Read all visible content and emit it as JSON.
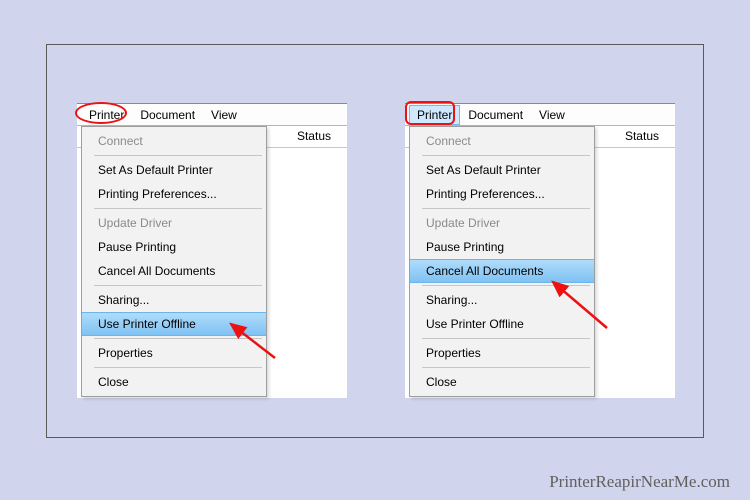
{
  "menubar": {
    "printer": "Printer",
    "document": "Document",
    "view": "View"
  },
  "columns": {
    "status": "Status"
  },
  "menu": {
    "connect": "Connect",
    "set_default": "Set As Default Printer",
    "printing_prefs": "Printing Preferences...",
    "update_driver": "Update Driver",
    "pause_printing": "Pause Printing",
    "cancel_all": "Cancel All Documents",
    "sharing": "Sharing...",
    "use_offline": "Use Printer Offline",
    "properties": "Properties",
    "close": "Close"
  },
  "watermark": "PrinterReapirNearMe.com"
}
